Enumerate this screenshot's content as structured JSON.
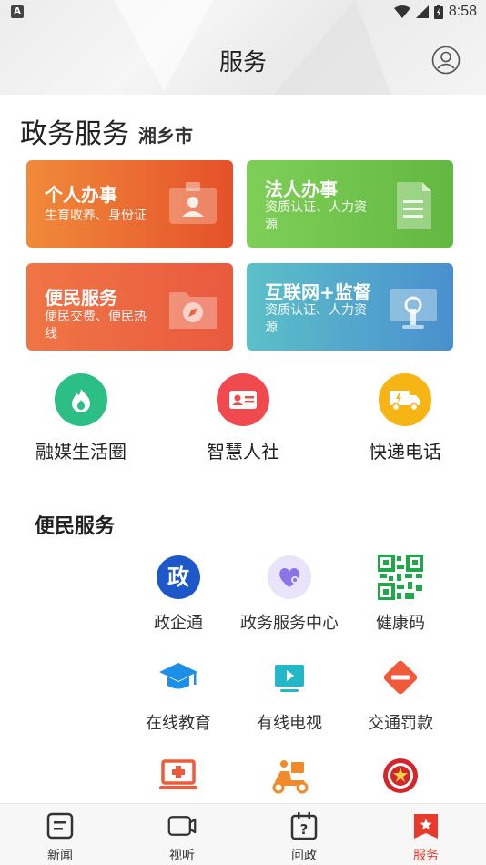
{
  "status_bar": {
    "time": "8:58",
    "left_badge": "A"
  },
  "header": {
    "title": "服务"
  },
  "gov": {
    "title": "政务服务",
    "city": "湘乡市"
  },
  "cards": [
    {
      "title": "个人办事",
      "subtitle": "生育收养、身份证",
      "color_from": "#f08a3a",
      "color_to": "#e5512a",
      "icon": "id-card-icon"
    },
    {
      "title": "法人办事",
      "subtitle": "资质认证、人力资源",
      "color_from": "#7fcf57",
      "color_to": "#62b842",
      "icon": "document-icon"
    },
    {
      "title": "便民服务",
      "subtitle": "便民交费、便民热线",
      "color_from": "#f07546",
      "color_to": "#e95a3e",
      "icon": "folder-compass-icon"
    },
    {
      "title": "互联网+监督",
      "subtitle": "资质认证、人力资源",
      "color_from": "#5cc0c8",
      "color_to": "#4a8fcf",
      "icon": "monitor-icon"
    }
  ],
  "apps": [
    {
      "label": "融媒生活圈",
      "color": "#2bbf86",
      "icon": "flame-icon"
    },
    {
      "label": "智慧人社",
      "color": "#f04a4e",
      "icon": "id-card-icon"
    },
    {
      "label": "快递电话",
      "color": "#f7b515",
      "icon": "delivery-truck-icon"
    }
  ],
  "convenience": {
    "title": "便民服务",
    "items": [
      {
        "label": "政企通",
        "icon": "zheng-icon",
        "glyph": "政"
      },
      {
        "label": "政务服务中心",
        "icon": "heart-chat-icon"
      },
      {
        "label": "健康码",
        "icon": "qr-code-icon"
      },
      {
        "label": "在线教育",
        "icon": "graduation-cap-icon"
      },
      {
        "label": "有线电视",
        "icon": "tv-play-icon"
      },
      {
        "label": "交通罚款",
        "icon": "no-entry-icon"
      },
      {
        "label": "",
        "icon": "medical-laptop-icon"
      },
      {
        "label": "",
        "icon": "scooter-delivery-icon"
      },
      {
        "label": "",
        "icon": "police-emblem-icon"
      }
    ]
  },
  "bottom_nav": [
    {
      "label": "新闻",
      "icon": "news-icon",
      "active": false
    },
    {
      "label": "视听",
      "icon": "video-icon",
      "active": false
    },
    {
      "label": "问政",
      "icon": "question-calendar-icon",
      "active": false
    },
    {
      "label": "服务",
      "icon": "service-bookmark-icon",
      "active": true
    }
  ],
  "colors": {
    "accent": "#e8392c",
    "text": "#222222"
  }
}
